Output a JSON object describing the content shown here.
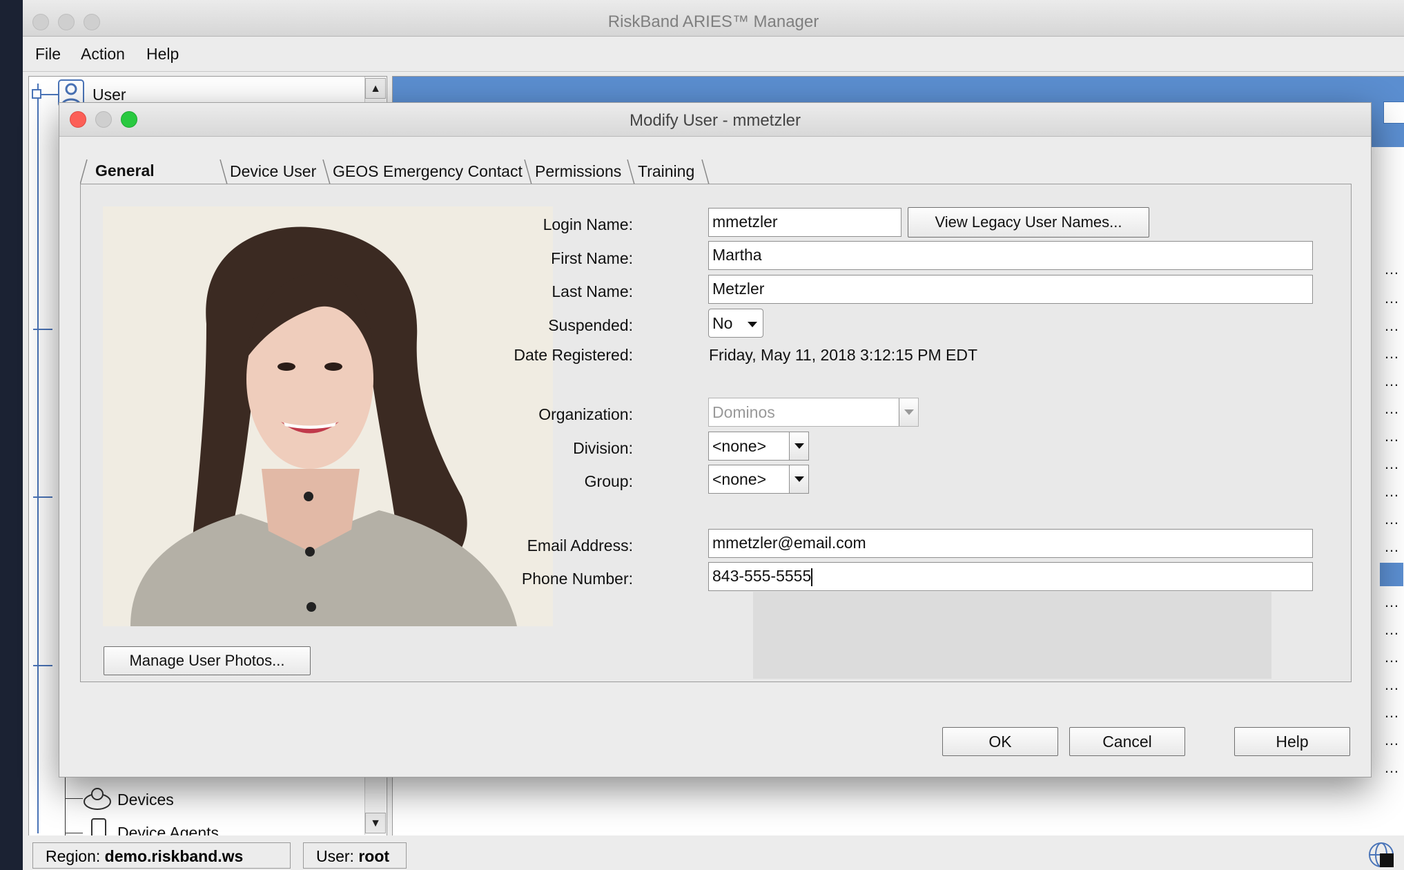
{
  "app": {
    "title": "RiskBand ARIES™ Manager",
    "menu": [
      "File",
      "Action",
      "Help"
    ]
  },
  "tree": {
    "items": [
      {
        "label": "User",
        "icon": "user-icon"
      },
      {
        "label": "Devices",
        "icon": "devices-icon"
      },
      {
        "label": "Device Agents",
        "icon": "device-agent-icon"
      }
    ]
  },
  "status": {
    "region_label": "Region:",
    "region_value": "demo.riskband.ws",
    "user_label": "User:",
    "user_value": "root"
  },
  "dialog": {
    "title": "Modify User - mmetzler",
    "tabs": [
      "General",
      "Device User",
      "GEOS Emergency Contact",
      "Permissions",
      "Training"
    ],
    "active_tab": "General",
    "fields": {
      "login_name_label": "Login Name:",
      "login_name": "mmetzler",
      "view_legacy_button": "View Legacy User Names...",
      "first_name_label": "First Name:",
      "first_name": "Martha",
      "last_name_label": "Last Name:",
      "last_name": "Metzler",
      "suspended_label": "Suspended:",
      "suspended": "No",
      "date_registered_label": "Date Registered:",
      "date_registered": "Friday, May 11, 2018 3:12:15 PM EDT",
      "organization_label": "Organization:",
      "organization": "Dominos",
      "division_label": "Division:",
      "division": "<none>",
      "group_label": "Group:",
      "group": "<none>",
      "email_label": "Email Address:",
      "email": "mmetzler@email.com",
      "phone_label": "Phone Number:",
      "phone": "843-555-5555"
    },
    "manage_photos_button": "Manage User Photos...",
    "buttons": {
      "ok": "OK",
      "cancel": "Cancel",
      "help": "Help"
    }
  },
  "colors": {
    "accent_blue": "#5b8ed0",
    "close_red": "#fc5f57",
    "minimize_gray": "#cfcfcf",
    "zoom_green": "#29c940"
  }
}
